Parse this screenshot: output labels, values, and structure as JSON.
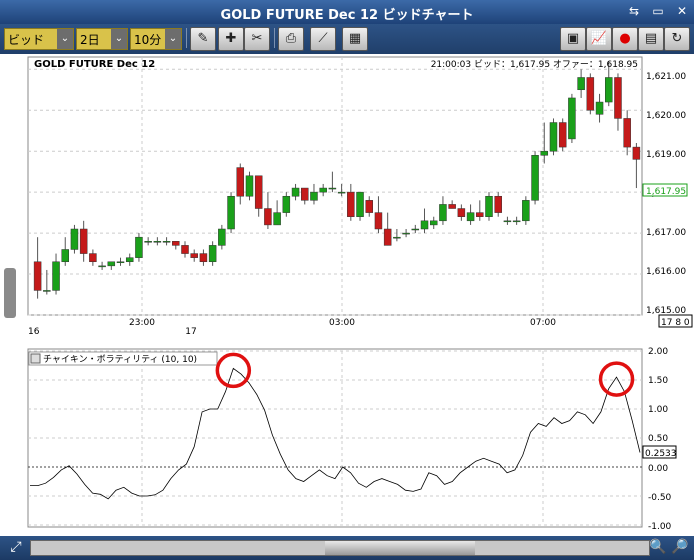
{
  "window": {
    "title": "GOLD FUTURE Dec 12 ビッドチャート"
  },
  "toolbar": {
    "price_type": "ビッド",
    "period": "2日",
    "interval": "10分"
  },
  "header": {
    "symbol": "GOLD FUTURE Dec 12",
    "quote": "21:00:03  ビッド：1,617.95  オファー：1,618.95"
  },
  "price_axis": {
    "ticks": [
      "1,621.00",
      "1,620.00",
      "1,619.00",
      "1,618.00",
      "1,617.00",
      "1,616.00",
      "1,615.00"
    ],
    "current_label": "1,617.95",
    "bottom_label": "17 8 0"
  },
  "time_axis": {
    "labels": [
      "16",
      "23:00",
      "17",
      "03:00",
      "07:00"
    ]
  },
  "indicator": {
    "name": "チャイキン・ボラティリティ (10, 10)",
    "ticks": [
      "2.00",
      "1.50",
      "1.00",
      "0.50",
      "0.00",
      "-0.50",
      "-1.00"
    ],
    "current_label": "0.2533"
  },
  "colors": {
    "up": "#1aa01a",
    "down": "#c41a1a",
    "highlight": "#e01010"
  },
  "chart_data": [
    {
      "type": "candlestick",
      "title": "GOLD FUTURE Dec 12",
      "ylim": [
        1615.0,
        1621.3
      ],
      "x_labels": [
        "16",
        "23:00",
        "17",
        "03:00",
        "07:00"
      ],
      "candles": [
        [
          1616.3,
          1616.9,
          1615.4,
          1615.6
        ],
        [
          1615.6,
          1616.1,
          1615.5,
          1615.6
        ],
        [
          1615.6,
          1616.5,
          1615.5,
          1616.3
        ],
        [
          1616.3,
          1616.9,
          1616.2,
          1616.6
        ],
        [
          1616.6,
          1617.2,
          1616.5,
          1617.1
        ],
        [
          1617.1,
          1617.3,
          1616.3,
          1616.5
        ],
        [
          1616.5,
          1616.6,
          1616.2,
          1616.3
        ],
        [
          1616.2,
          1616.3,
          1616.1,
          1616.2
        ],
        [
          1616.2,
          1616.3,
          1616.1,
          1616.3
        ],
        [
          1616.3,
          1616.4,
          1616.2,
          1616.3
        ],
        [
          1616.3,
          1616.5,
          1616.2,
          1616.4
        ],
        [
          1616.4,
          1617.0,
          1616.3,
          1616.9
        ],
        [
          1616.8,
          1616.9,
          1616.7,
          1616.8
        ],
        [
          1616.8,
          1616.9,
          1616.7,
          1616.8
        ],
        [
          1616.8,
          1616.9,
          1616.7,
          1616.8
        ],
        [
          1616.8,
          1616.8,
          1616.6,
          1616.7
        ],
        [
          1616.7,
          1616.8,
          1616.4,
          1616.5
        ],
        [
          1616.5,
          1616.6,
          1616.3,
          1616.4
        ],
        [
          1616.5,
          1616.6,
          1616.2,
          1616.3
        ],
        [
          1616.3,
          1616.8,
          1616.2,
          1616.7
        ],
        [
          1616.7,
          1617.2,
          1616.6,
          1617.1
        ],
        [
          1617.1,
          1618.0,
          1617.0,
          1617.9
        ],
        [
          1618.6,
          1618.7,
          1617.7,
          1617.9
        ],
        [
          1617.9,
          1618.5,
          1617.8,
          1618.4
        ],
        [
          1618.4,
          1618.4,
          1617.4,
          1617.6
        ],
        [
          1617.6,
          1618.0,
          1617.1,
          1617.2
        ],
        [
          1617.2,
          1617.8,
          1617.2,
          1617.5
        ],
        [
          1617.5,
          1618.0,
          1617.4,
          1617.9
        ],
        [
          1617.9,
          1618.2,
          1617.8,
          1618.1
        ],
        [
          1618.1,
          1618.1,
          1617.7,
          1617.8
        ],
        [
          1617.8,
          1618.2,
          1617.7,
          1618.0
        ],
        [
          1618.0,
          1618.2,
          1617.9,
          1618.1
        ],
        [
          1618.1,
          1618.5,
          1618.0,
          1618.1
        ],
        [
          1618.0,
          1618.2,
          1617.9,
          1618.0
        ],
        [
          1618.0,
          1618.2,
          1617.3,
          1617.4
        ],
        [
          1617.4,
          1618.0,
          1617.3,
          1618.0
        ],
        [
          1617.8,
          1617.9,
          1617.4,
          1617.5
        ],
        [
          1617.5,
          1617.9,
          1617.0,
          1617.1
        ],
        [
          1617.1,
          1617.5,
          1616.7,
          1616.7
        ],
        [
          1616.9,
          1617.1,
          1616.8,
          1616.9
        ],
        [
          1617.0,
          1617.1,
          1616.9,
          1617.0
        ],
        [
          1617.1,
          1617.2,
          1617.0,
          1617.1
        ],
        [
          1617.1,
          1617.6,
          1617.0,
          1617.3
        ],
        [
          1617.2,
          1617.4,
          1617.1,
          1617.3
        ],
        [
          1617.3,
          1617.9,
          1617.2,
          1617.7
        ],
        [
          1617.7,
          1617.8,
          1617.6,
          1617.6
        ],
        [
          1617.6,
          1617.7,
          1617.3,
          1617.4
        ],
        [
          1617.3,
          1617.7,
          1617.2,
          1617.5
        ],
        [
          1617.5,
          1617.8,
          1617.3,
          1617.4
        ],
        [
          1617.4,
          1618.0,
          1617.3,
          1617.9
        ],
        [
          1617.9,
          1618.0,
          1617.4,
          1617.5
        ],
        [
          1617.3,
          1617.4,
          1617.2,
          1617.3
        ],
        [
          1617.3,
          1617.4,
          1617.2,
          1617.3
        ],
        [
          1617.3,
          1617.9,
          1617.2,
          1617.8
        ],
        [
          1617.8,
          1619.0,
          1617.7,
          1618.9
        ],
        [
          1618.9,
          1619.7,
          1618.7,
          1619.0
        ],
        [
          1619.0,
          1619.8,
          1618.9,
          1619.7
        ],
        [
          1619.7,
          1619.8,
          1619.0,
          1619.1
        ],
        [
          1619.3,
          1620.4,
          1619.2,
          1620.3
        ],
        [
          1620.5,
          1621.0,
          1620.3,
          1620.8
        ],
        [
          1620.8,
          1620.9,
          1619.9,
          1620.0
        ],
        [
          1619.9,
          1620.4,
          1619.7,
          1620.2
        ],
        [
          1620.2,
          1621.2,
          1620.1,
          1620.8
        ],
        [
          1620.8,
          1620.9,
          1619.5,
          1619.8
        ],
        [
          1619.8,
          1620.0,
          1618.9,
          1619.1
        ],
        [
          1619.1,
          1619.2,
          1618.1,
          1618.8
        ]
      ]
    },
    {
      "type": "line",
      "title": "チャイキン・ボラティリティ (10, 10)",
      "ylim": [
        -1.0,
        2.0
      ],
      "values": [
        -0.32,
        -0.32,
        -0.28,
        -0.18,
        -0.05,
        0.02,
        -0.12,
        -0.3,
        -0.45,
        -0.47,
        -0.55,
        -0.4,
        -0.35,
        -0.45,
        -0.5,
        -0.5,
        -0.48,
        -0.4,
        -0.2,
        -0.05,
        0.05,
        0.35,
        0.95,
        1.0,
        1.0,
        1.3,
        1.7,
        1.6,
        1.45,
        1.25,
        0.98,
        0.55,
        0.22,
        -0.05,
        -0.2,
        -0.25,
        -0.15,
        -0.05,
        -0.15,
        -0.2,
        0.0,
        -0.1,
        -0.28,
        -0.35,
        -0.25,
        -0.2,
        -0.25,
        -0.3,
        -0.4,
        -0.42,
        -0.38,
        -0.1,
        -0.15,
        -0.3,
        -0.25,
        -0.1,
        0.0,
        0.1,
        0.15,
        0.1,
        0.05,
        -0.1,
        -0.05,
        0.2,
        0.6,
        0.75,
        0.7,
        0.85,
        0.75,
        0.8,
        0.95,
        0.9,
        0.75,
        0.95,
        1.35,
        1.55,
        1.3,
        0.8,
        0.25
      ],
      "highlight_peaks": [
        26,
        75
      ]
    }
  ]
}
